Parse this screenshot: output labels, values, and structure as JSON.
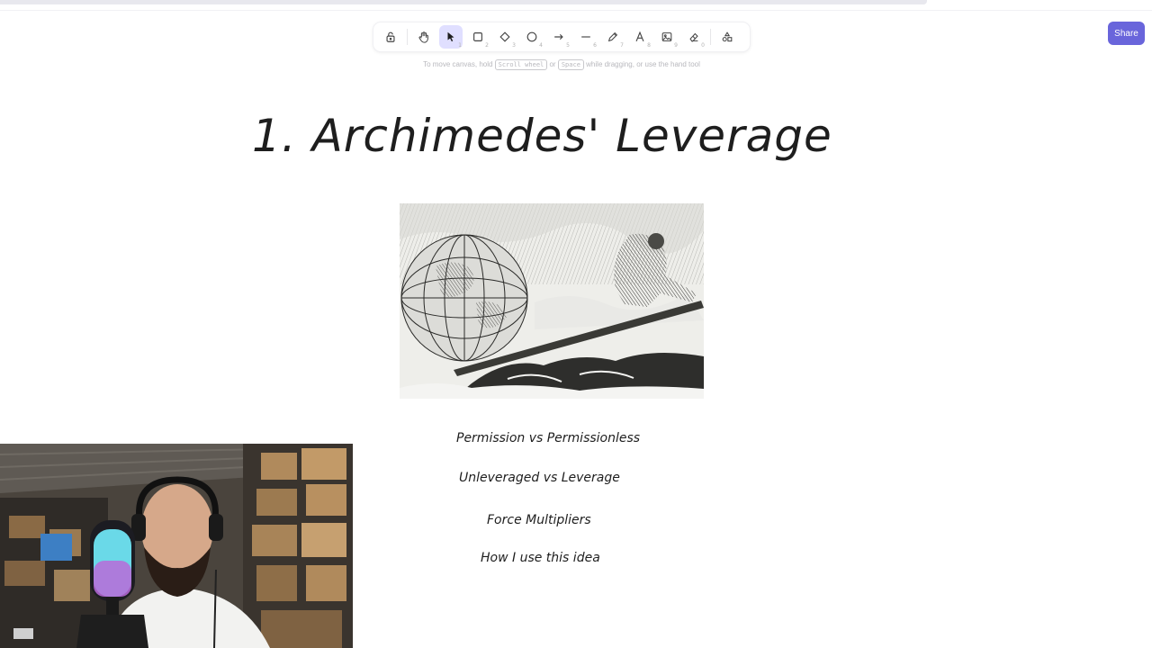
{
  "toolbar": {
    "tools": [
      {
        "name": "lock",
        "key": ""
      },
      {
        "name": "hand",
        "key": ""
      },
      {
        "name": "selection",
        "key": "1"
      },
      {
        "name": "rectangle",
        "key": "2"
      },
      {
        "name": "diamond",
        "key": "3"
      },
      {
        "name": "ellipse",
        "key": "4"
      },
      {
        "name": "arrow",
        "key": "5"
      },
      {
        "name": "line",
        "key": "6"
      },
      {
        "name": "draw",
        "key": "7"
      },
      {
        "name": "text",
        "key": "8"
      },
      {
        "name": "image",
        "key": "9"
      },
      {
        "name": "eraser",
        "key": "0"
      },
      {
        "name": "extra-tools",
        "key": ""
      }
    ],
    "active_tool": "selection",
    "accent_color": "#6965db"
  },
  "hint": {
    "prefix": "To move canvas, hold",
    "key1": "Scroll wheel",
    "or": "or",
    "key2": "Space",
    "suffix": "while dragging, or use the hand tool"
  },
  "share": {
    "label": "Share"
  },
  "canvas": {
    "title": "1. Archimedes' Leverage",
    "notes": [
      "Permission vs Permissionless",
      "Unleveraged vs Leverage",
      "Force Multipliers",
      "How I use this idea"
    ]
  }
}
